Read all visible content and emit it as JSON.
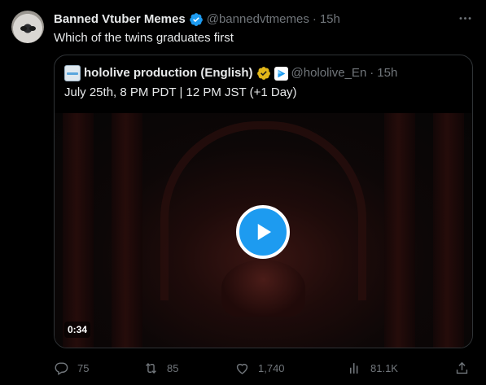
{
  "tweet": {
    "author": {
      "display_name": "Banned Vtuber Memes",
      "handle": "@bannedvtmemes",
      "separator": "·",
      "time": "15h"
    },
    "text": "Which of the twins graduates first"
  },
  "quote": {
    "author": {
      "display_name": "hololive production (English)",
      "handle": "@hololive_En",
      "separator": "·",
      "time": "15h"
    },
    "text": "July 25th, 8 PM PDT | 12 PM JST (+1 Day)",
    "media": {
      "duration": "0:34"
    }
  },
  "actions": {
    "replies": "75",
    "reposts": "85",
    "likes": "1,740",
    "views": "81.1K"
  },
  "colors": {
    "background": "#000000",
    "text": "#e7e9ea",
    "secondary": "#71767b",
    "accent": "#1d9bf0",
    "gold": "#e2b719",
    "border": "#2f3336"
  },
  "icons": [
    "verified-badge-icon",
    "more-icon",
    "gold-verified-badge-icon",
    "affiliate-badge-icon",
    "play-icon",
    "reply-icon",
    "repost-icon",
    "like-icon",
    "views-icon",
    "share-icon"
  ]
}
